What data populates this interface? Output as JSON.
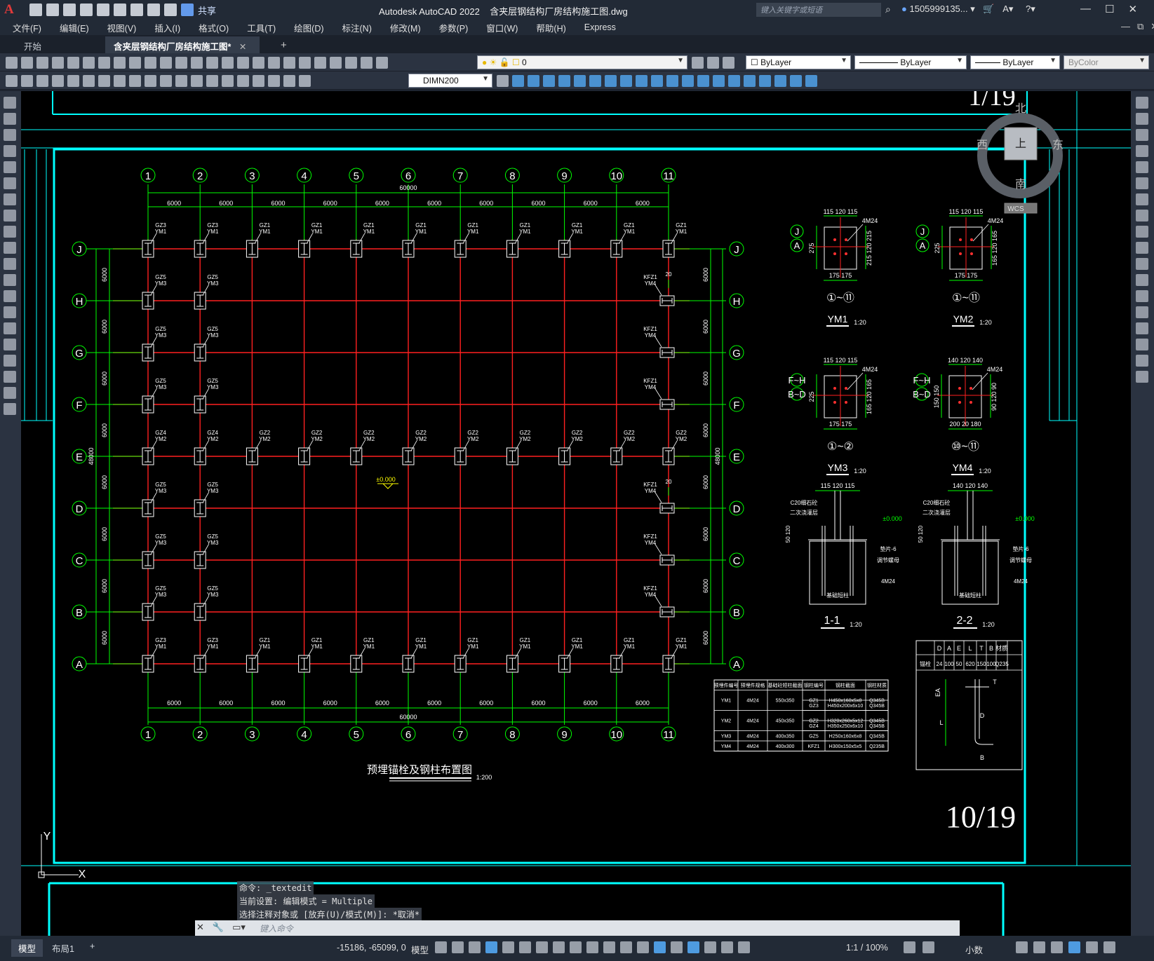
{
  "app": {
    "title": "Autodesk AutoCAD 2022",
    "filename": "含夹层钢结构厂房结构施工图.dwg",
    "share_label": "共享",
    "search_placeholder": "键入关键字或短语",
    "user": "1505999135...",
    "logo_letter": "A"
  },
  "menu": [
    "文件(F)",
    "编辑(E)",
    "视图(V)",
    "插入(I)",
    "格式(O)",
    "工具(T)",
    "绘图(D)",
    "标注(N)",
    "修改(M)",
    "参数(P)",
    "窗口(W)",
    "帮助(H)",
    "Express"
  ],
  "tabs": {
    "start": "开始",
    "active": "含夹层钢结构厂房结构施工图*",
    "plus": "+"
  },
  "toolbar": {
    "layer": "0",
    "color": "ByLayer",
    "linetype": "ByLayer",
    "lineweight": "ByLayer",
    "plotstyle": "ByColor",
    "dimstyle": "DIMN200"
  },
  "drawing": {
    "sheet_top": "1/19",
    "sheet_bottom": "10/19",
    "plan_title": "预埋锚栓及钢柱布置图",
    "plan_scale": "1:200",
    "grid_cols": [
      "1",
      "2",
      "3",
      "4",
      "5",
      "6",
      "7",
      "8",
      "9",
      "10",
      "11"
    ],
    "grid_rows": [
      "J",
      "H",
      "G",
      "F",
      "E",
      "D",
      "C",
      "B",
      "A"
    ],
    "bay": "6000",
    "total_x": "60000",
    "total_y": "48000",
    "elevation": "±0.000",
    "top_row_labels": [
      "GZ3",
      "GZ3",
      "GZ1",
      "GZ1",
      "GZ1",
      "GZ1",
      "GZ1",
      "GZ1",
      "GZ1",
      "GZ1",
      "GZ1"
    ],
    "top_row_ym": [
      "YM1",
      "YM1",
      "YM1",
      "YM1",
      "YM1",
      "YM1",
      "YM1",
      "YM1",
      "YM1",
      "YM1",
      "YM1"
    ],
    "mid_row_labels": [
      "GZ4",
      "GZ4",
      "GZ2",
      "GZ2",
      "GZ2",
      "GZ2",
      "GZ2",
      "GZ2",
      "GZ2",
      "GZ2",
      "GZ2"
    ],
    "mid_row_ym": [
      "YM2",
      "YM2",
      "YM2",
      "YM2",
      "YM2",
      "YM2",
      "YM2",
      "YM2",
      "YM2",
      "YM2",
      "YM2"
    ],
    "side_label_gz": "GZ5",
    "side_label_ym": "YM3",
    "right_label_kfz": "KFZ1",
    "right_label_ym": "YM4",
    "dim_20": "20",
    "details": [
      {
        "name": "YM1",
        "scale": "1:20",
        "axes": "①~⑪",
        "tag1": "J",
        "tag2": "A",
        "bolt": "4M24",
        "top": "115 120 115",
        "bottom": "175 175",
        "side_l": "275",
        "side_r": "215 120 215"
      },
      {
        "name": "YM2",
        "scale": "1:20",
        "axes": "①~⑪",
        "tag1": "J",
        "tag2": "A",
        "bolt": "4M24",
        "top": "115 120 115",
        "bottom": "175 175",
        "side_l": "225",
        "side_r": "165 120 165"
      },
      {
        "name": "YM3",
        "scale": "1:20",
        "axes": "①~②",
        "tag1": "F~H",
        "tag2": "B~D",
        "bolt": "4M24",
        "top": "115 120 115",
        "bottom": "175 175",
        "side_l": "225",
        "side_r": "165 120 165"
      },
      {
        "name": "YM4",
        "scale": "1:20",
        "axes": "⑩~⑪",
        "tag1": "F~H",
        "tag2": "B~D",
        "bolt": "4M24",
        "top": "140 120 140",
        "bottom": "200 20 180",
        "side_l": "150 150",
        "side_r": "90 120 90"
      }
    ],
    "sections": [
      {
        "name": "1-1",
        "scale": "1:20",
        "top": "115  120  115",
        "concrete": "C20细石砼",
        "grout": "二次浇灌层",
        "elev": "±0.000",
        "plate": "垫片-6",
        "nut": "调节螺母",
        "bolt": "4M24",
        "base": "基础短柱",
        "dims": "50 120"
      },
      {
        "name": "2-2",
        "scale": "1:20",
        "top": "140  120  140",
        "concrete": "C20细石砼",
        "grout": "二次浇灌层",
        "elev": "±0.000",
        "plate": "垫片-6",
        "nut": "调节螺母",
        "bolt": "4M24",
        "base": "基础短柱",
        "dims": "50 120"
      }
    ],
    "col_table": {
      "headers": [
        "预埋件编号",
        "预埋件规格",
        "基础砼短柱截面",
        "钢柱编号",
        "钢柱截面",
        "钢柱材质"
      ],
      "rows": [
        [
          "YM1",
          "4M24",
          "550x350",
          "GZ1",
          "H450x160x5x8",
          "Q345B"
        ],
        [
          "",
          "",
          "",
          "GZ3",
          "H450x200x6x10",
          "Q345B"
        ],
        [
          "YM2",
          "4M24",
          "450x350",
          "GZ2",
          "H320x260x5x12",
          "Q345B"
        ],
        [
          "",
          "",
          "",
          "GZ4",
          "H350x250x6x10",
          "Q345B"
        ],
        [
          "YM3",
          "4M24",
          "400x350",
          "GZ5",
          "H250x160x6x8",
          "Q345B"
        ],
        [
          "YM4",
          "4M24",
          "400x300",
          "KFZ1",
          "H300x150x5x5",
          "Q235B"
        ]
      ]
    },
    "bolt_table": {
      "headers": [
        "",
        "D",
        "A",
        "E",
        "L",
        "T",
        "B",
        "材质"
      ],
      "row": [
        "锚栓",
        "24",
        "100",
        "50",
        "620",
        "150",
        "100",
        "Q235"
      ],
      "labels": {
        "ea": "EA",
        "t": "T",
        "l": "L",
        "d": "D",
        "b": "B"
      }
    },
    "compass": {
      "n": "北",
      "s": "南",
      "w": "西",
      "e": "东",
      "top": "上",
      "wcs": "WCS"
    },
    "ucs": {
      "y": "Y",
      "x": "X"
    }
  },
  "command": {
    "history": [
      "命令: _textedit",
      "当前设置: 编辑模式 = Multiple",
      "选择注释对象或 [放弃(U)/模式(M)]: *取消*"
    ],
    "placeholder": "键入命令"
  },
  "status": {
    "model_tab": "模型",
    "layout_tab": "布局1",
    "plus": "+",
    "coords": "-15186, -65099, 0",
    "space": "模型",
    "scale": "1:1 / 100%",
    "units": "小数"
  },
  "colors": {
    "grid_red": "#ff2020",
    "dim_green": "#00ff00",
    "frame_cyan": "#00ffff",
    "text_white": "#ffffff"
  }
}
